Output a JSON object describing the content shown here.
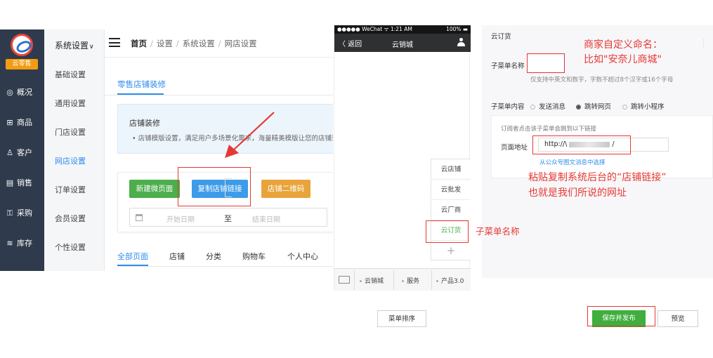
{
  "colors": {
    "nav_bg": "#2f3b4c",
    "primary_blue": "#2e8ded",
    "green": "#4cae4c",
    "orange": "#e8a43a",
    "annotation_red": "#e53935"
  },
  "admin": {
    "logo_text": "云零售",
    "left_nav": [
      {
        "label": "概况",
        "icon": "dashboard-icon",
        "glyph": "◎"
      },
      {
        "label": "商品",
        "icon": "grid-icon",
        "glyph": "⊞"
      },
      {
        "label": "客户",
        "icon": "user-icon",
        "glyph": "♙"
      },
      {
        "label": "销售",
        "icon": "document-icon",
        "glyph": "▤"
      },
      {
        "label": "采购",
        "icon": "cart-icon",
        "glyph": "⚿"
      },
      {
        "label": "库存",
        "icon": "layers-icon",
        "glyph": "≋"
      }
    ],
    "sub_nav_title": "系统设置",
    "sub_nav_caret": "∨",
    "sub_nav": [
      "基础设置",
      "通用设置",
      "门店设置",
      "网店设置",
      "订单设置",
      "会员设置",
      "个性设置"
    ],
    "sub_nav_active": "网店设置",
    "breadcrumb": {
      "home": "首页",
      "items": [
        "设置",
        "系统设置",
        "网店设置"
      ],
      "separator": "/"
    },
    "section_tab": "零售店铺装修",
    "info": {
      "title": "店铺装修",
      "desc": "店铺模版设置，满足用户多场景化需求，海量精美模版让您的店铺更…"
    },
    "buttons": {
      "new_page": "新建微页面",
      "copy_link": "复制店铺链接",
      "qr_code": "店铺二维码"
    },
    "date": {
      "start_placeholder": "开始日期",
      "to": "至",
      "end_placeholder": "结束日期"
    },
    "filter_tabs": [
      "全部页面",
      "店铺",
      "分类",
      "购物车",
      "个人中心"
    ]
  },
  "phone": {
    "status": {
      "carrier": "●●●●● WeChat ᯤ",
      "time": "1:21 AM",
      "battery": "100% ▬"
    },
    "back": "〈 返回",
    "title": "云销城",
    "submenu": [
      "云店铺",
      "云批发",
      "云厂商",
      "云订货"
    ],
    "submenu_active": "云订货",
    "plus": "+",
    "bottom_menu": [
      "云销城",
      "服务",
      "产品3.0"
    ]
  },
  "config": {
    "title": "云订货",
    "dots": "·\n·\n·",
    "name_label": "子菜单名称",
    "name_hint": "仅支持中英文和数字，字数不超过8个汉字或16个字母",
    "content_label": "子菜单内容",
    "options": [
      "发送消息",
      "跳转网页",
      "跳转小程序"
    ],
    "option_selected": "跳转网页",
    "link_desc": "订阅者点击该子菜单会跳到以下链接",
    "url_label": "页面地址",
    "url_prefix": "http://\\",
    "url_suffix": "/",
    "pick_link": "从公众号图文消息中选择"
  },
  "footer": {
    "menu_sort": "菜单排序",
    "save_publish": "保存并发布",
    "preview": "预览"
  },
  "annotations": {
    "merchant_name_1": "商家自定义命名：",
    "merchant_name_2": "比如\"安奈儿商城\"",
    "paste_link_1": "粘贴复制系统后台的“店铺链接”",
    "paste_link_2": "也就是我们所说的网址",
    "submenu_name": "子菜单名称"
  }
}
